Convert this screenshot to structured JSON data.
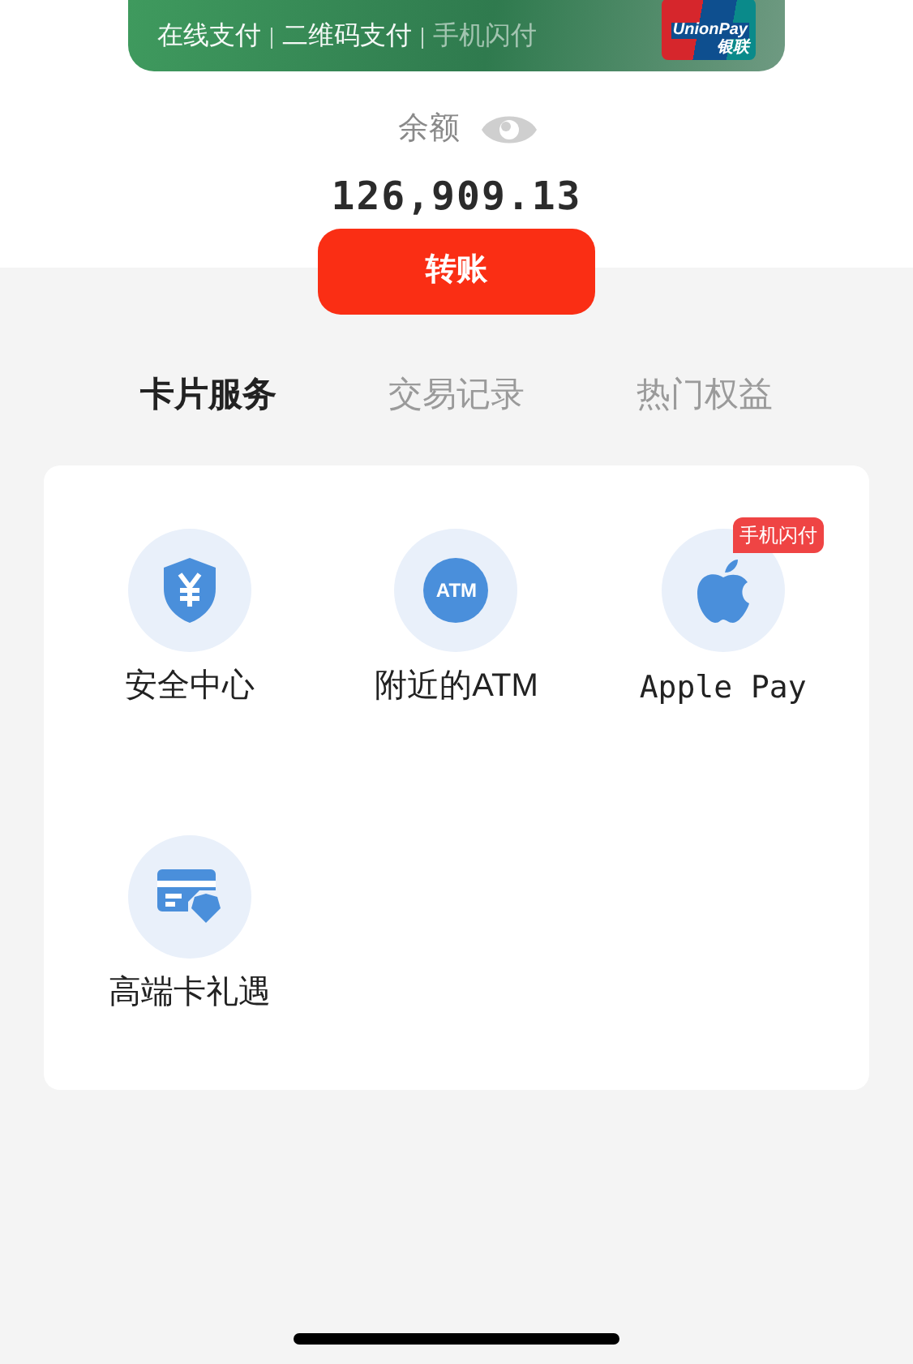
{
  "bank_card": {
    "pay_methods": [
      {
        "label": "在线支付",
        "dim": false
      },
      {
        "label": "二维码支付",
        "dim": false
      },
      {
        "label": "手机闪付",
        "dim": true
      }
    ],
    "logo_texts": [
      "UnionPay",
      "银联"
    ]
  },
  "balance": {
    "label": "余额",
    "amount": "126,909.13"
  },
  "transfer_button": "转账",
  "tabs": [
    {
      "label": "卡片服务",
      "selected": true
    },
    {
      "label": "交易记录",
      "selected": false
    },
    {
      "label": "热门权益",
      "selected": false
    }
  ],
  "services": [
    {
      "kind": "shield",
      "label": "安全中心",
      "mono": false
    },
    {
      "kind": "atm",
      "label": "附近的ATM",
      "icon_text": "ATM",
      "mono": false
    },
    {
      "kind": "apple",
      "label": "Apple Pay",
      "badge": "手机闪付",
      "mono": true
    },
    {
      "kind": "card",
      "label": "高端卡礼遇",
      "mono": false
    }
  ]
}
